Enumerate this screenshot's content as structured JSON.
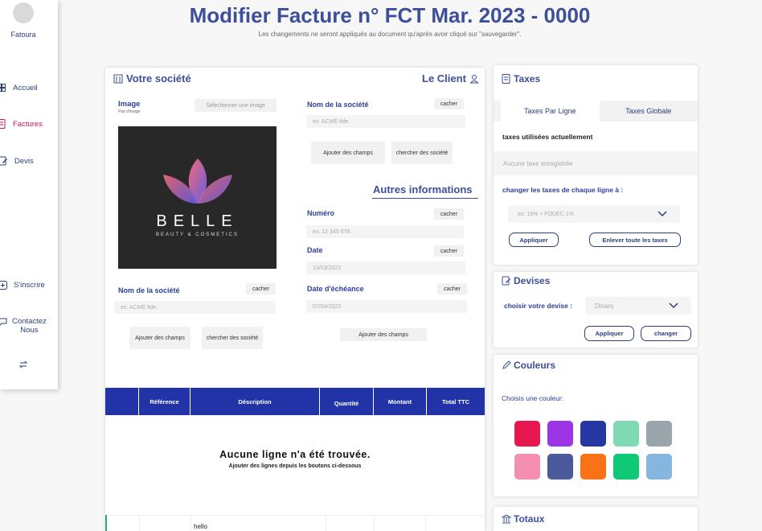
{
  "sidebar": {
    "brand": "Fatoura",
    "items": [
      {
        "label": "Accueil"
      },
      {
        "label": "Factures"
      },
      {
        "label": "Devis"
      },
      {
        "label": "S'inscrire"
      },
      {
        "label": "Contactez\nNous"
      }
    ]
  },
  "header": {
    "title": "Modifier Facture n° FCT Mar. 2023 - 0000",
    "subtitle": "Les changements ne seront appliqués au document qu'après avoir cliqué sur \"sauvegarder\"."
  },
  "company": {
    "title": "Votre société",
    "image_label": "Image",
    "image_sub": "Pas d'image",
    "select_image": "Sélectionner une image",
    "logo_text": "BELLE",
    "logo_sub": "BEAUTY & COSMETICS",
    "name_label": "Nom de la société",
    "hide": "cacher",
    "name_placeholder": "ex: ACME ltde.",
    "add_fields": "Ajouter des champs",
    "search_company": "chercher des société"
  },
  "client": {
    "title": "Le Client",
    "name_label": "Nom de la société",
    "hide": "cacher",
    "name_placeholder": "ex: ACME ltde.",
    "add_fields": "Ajouter des champs",
    "search_company": "chercher des société"
  },
  "other_info": {
    "title": "Autres informations",
    "number_label": "Numéro",
    "number_placeholder": "ex: 12 345 678.",
    "date_label": "Date",
    "date_value": "13/03/2023",
    "due_label": "Date d'échéance",
    "due_value": "07/04/2023",
    "hide": "cacher",
    "add_fields": "Ajouter des champs"
  },
  "table": {
    "columns": [
      "",
      "Référence",
      "Déscription",
      "Quantité",
      "Montant",
      "Total TTC"
    ],
    "empty_title": "Aucune ligne n'a été trouvée.",
    "empty_sub": "Ajouter des lignes depuis les boutons ci-dessous",
    "row_description": "hello"
  },
  "taxes": {
    "title": "Taxes",
    "tab_line": "Taxes Par Ligne",
    "tab_global": "Taxes Globale",
    "current_label": "taxes utilisées actuellement",
    "none": "Aucune taxe enregistrée",
    "change_label": "changer les taxes de chaque ligne à :",
    "select_placeholder": "ex: 19% + FODEC 1%",
    "apply": "Appliquer",
    "remove_all": "Enlever toute les taxes"
  },
  "currency": {
    "title": "Devises",
    "choose_label": "choisir votre devise :",
    "selected": "Dinars",
    "apply": "Appliquer",
    "change": "changer"
  },
  "colors": {
    "title": "Couleurs",
    "choose_label": "Choisis une couleur:",
    "swatches": [
      "#e8174f",
      "#9c35e6",
      "#2537a3",
      "#7fd9b3",
      "#9aa4ab",
      "#f48fb1",
      "#4a5a9a",
      "#f97316",
      "#10c977",
      "#86b6e0"
    ]
  },
  "totals": {
    "title": "Totaux"
  }
}
